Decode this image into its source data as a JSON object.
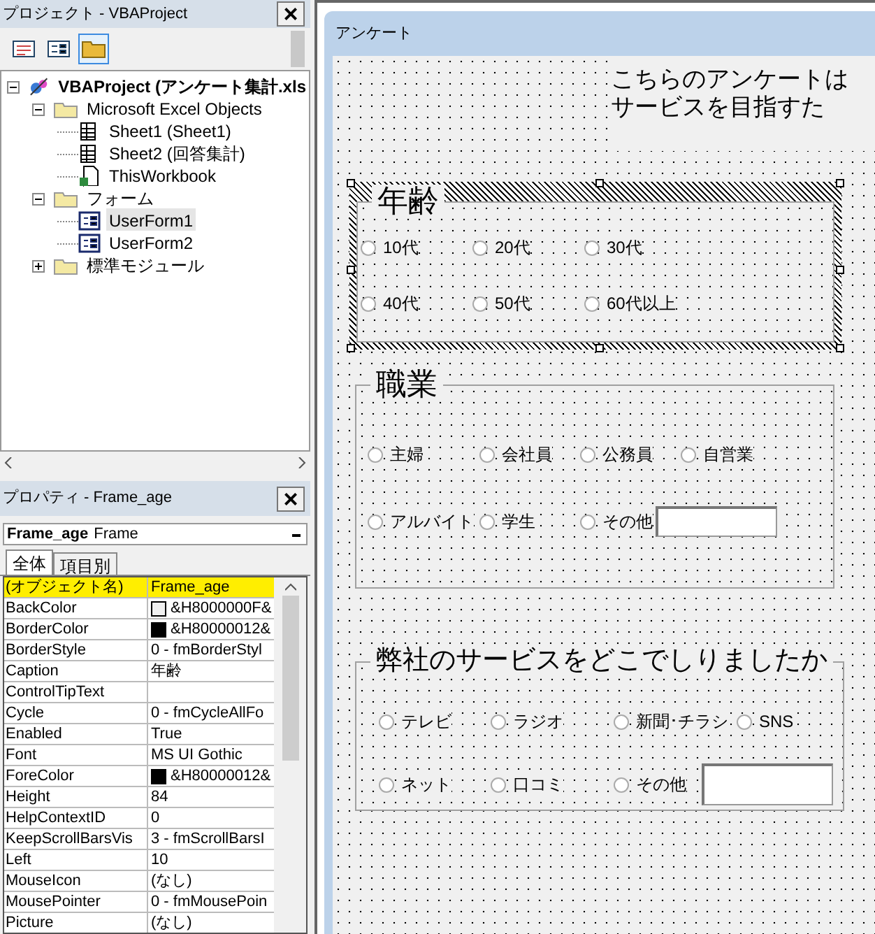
{
  "project": {
    "title": "プロジェクト - VBAProject",
    "close": "×",
    "toolbar": [
      {
        "kind": "view-code",
        "selected": false
      },
      {
        "kind": "view-object",
        "selected": false
      },
      {
        "kind": "toggle-folders",
        "selected": true
      }
    ],
    "tree": [
      {
        "kind": "project",
        "label": "VBAProject (アンケート集計.xls",
        "expanded": true,
        "selected": false,
        "children": [
          {
            "kind": "folder",
            "label": "Microsoft Excel Objects",
            "expanded": true,
            "selected": false,
            "children": [
              {
                "kind": "sheet",
                "label": "Sheet1 (Sheet1)",
                "selected": false
              },
              {
                "kind": "sheet",
                "label": "Sheet2 (回答集計)",
                "selected": false
              },
              {
                "kind": "workbook",
                "label": "ThisWorkbook",
                "selected": false
              }
            ]
          },
          {
            "kind": "folder",
            "label": "フォーム",
            "expanded": true,
            "selected": false,
            "children": [
              {
                "kind": "form",
                "label": "UserForm1",
                "selected": true
              },
              {
                "kind": "form",
                "label": "UserForm2",
                "selected": false
              }
            ]
          },
          {
            "kind": "folder",
            "label": "標準モジュール",
            "expanded": false,
            "selected": false
          }
        ]
      }
    ]
  },
  "properties": {
    "title": "プロパティ - Frame_age",
    "close": "×",
    "object_name": "Frame_age",
    "object_type": "Frame",
    "tabs": [
      {
        "label": "全体",
        "selected": true
      },
      {
        "label": "項目別",
        "selected": false
      }
    ],
    "rows": [
      {
        "name": "(オブジェクト名)",
        "value": "Frame_age",
        "selected": true
      },
      {
        "name": "BackColor",
        "value": "&H8000000F&",
        "color": "#f0f0f0",
        "selected": false
      },
      {
        "name": "BorderColor",
        "value": "&H80000012&",
        "color": "#000000",
        "selected": false
      },
      {
        "name": "BorderStyle",
        "value": "0 - fmBorderStyl",
        "selected": false
      },
      {
        "name": "Caption",
        "value": "年齢",
        "selected": false
      },
      {
        "name": "ControlTipText",
        "selected": false
      },
      {
        "name": "Cycle",
        "value": "0 - fmCycleAllFo",
        "selected": false
      },
      {
        "name": "Enabled",
        "value": "True",
        "selected": false
      },
      {
        "name": "Font",
        "value": "MS UI Gothic",
        "selected": false
      },
      {
        "name": "ForeColor",
        "value": "&H80000012&",
        "color": "#000000",
        "selected": false
      },
      {
        "name": "Height",
        "value": "84",
        "selected": false
      },
      {
        "name": "HelpContextID",
        "value": "0",
        "selected": false
      },
      {
        "name": "KeepScrollBarsVis",
        "value": "3 - fmScrollBarsI",
        "selected": false
      },
      {
        "name": "Left",
        "value": "10",
        "selected": false
      },
      {
        "name": "MouseIcon",
        "value": "(なし)",
        "selected": false
      },
      {
        "name": "MousePointer",
        "value": "0 - fmMousePoin",
        "selected": false
      },
      {
        "name": "Picture",
        "value": "(なし)",
        "selected": false
      }
    ]
  },
  "form": {
    "title": "アンケート",
    "intro": [
      "こちらのアンケートは",
      "サービスを目指すた"
    ],
    "frames": [
      {
        "caption": "年齢",
        "selected": true,
        "rows": [
          [
            {
              "kind": "radio",
              "label": "10代",
              "selected": false
            },
            {
              "kind": "radio",
              "label": "20代",
              "selected": false
            },
            {
              "kind": "radio",
              "label": "30代",
              "selected": false
            }
          ],
          [
            {
              "kind": "radio",
              "label": "40代",
              "selected": false
            },
            {
              "kind": "radio",
              "label": "50代",
              "selected": false
            },
            {
              "kind": "radio",
              "label": "60代以上",
              "selected": false
            }
          ]
        ]
      },
      {
        "caption": "職業",
        "selected": false,
        "rows": [
          [
            {
              "kind": "radio",
              "label": "主婦",
              "selected": false
            },
            {
              "kind": "radio",
              "label": "会社員",
              "selected": false
            },
            {
              "kind": "radio",
              "label": "公務員",
              "selected": false
            },
            {
              "kind": "radio",
              "label": "自営業",
              "selected": false
            }
          ],
          [
            {
              "kind": "radio",
              "label": "アルバイト",
              "selected": false
            },
            {
              "kind": "radio",
              "label": "学生",
              "selected": false
            },
            {
              "kind": "radio",
              "label": "その他",
              "selected": false
            },
            {
              "kind": "textbox"
            }
          ]
        ]
      },
      {
        "caption": "弊社のサービスをどこでしりましたか",
        "selected": false,
        "rows": [
          [
            {
              "kind": "radio",
              "label": "テレビ",
              "selected": false
            },
            {
              "kind": "radio",
              "label": "ラジオ",
              "selected": false
            },
            {
              "kind": "radio",
              "label": "新聞･チラシ",
              "selected": false
            },
            {
              "kind": "radio",
              "label": "SNS",
              "selected": false
            }
          ],
          [
            {
              "kind": "radio",
              "label": "ネット",
              "selected": false
            },
            {
              "kind": "radio",
              "label": "口コミ",
              "selected": false
            },
            {
              "kind": "radio",
              "label": "その他",
              "selected": false
            },
            {
              "kind": "textbox"
            }
          ]
        ]
      }
    ]
  }
}
